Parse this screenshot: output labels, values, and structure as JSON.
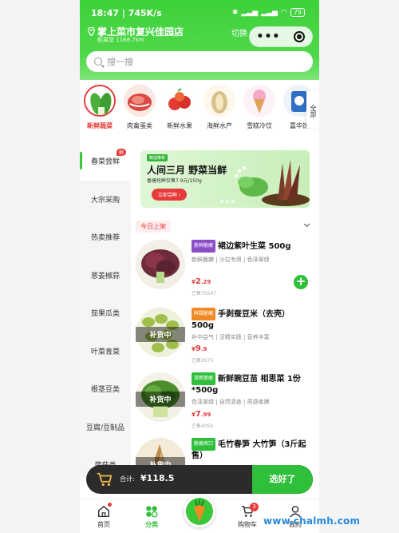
{
  "status": {
    "time": "18:47 | 745K/s",
    "battery": "79"
  },
  "header": {
    "location": "掌上菜市复兴佳园店",
    "distance": "距离您 1168.7km",
    "switch_label": "切换 ›"
  },
  "search": {
    "placeholder": "搜一搜"
  },
  "categories": [
    {
      "label": "新鲜蔬菜",
      "selected": true
    },
    {
      "label": "肉禽蛋类",
      "selected": false
    },
    {
      "label": "新鲜水果",
      "selected": false
    },
    {
      "label": "海鲜水产",
      "selected": false
    },
    {
      "label": "雪糕冷饮",
      "selected": false
    },
    {
      "label": "嘉华饼",
      "selected": false
    }
  ],
  "all_label": "全部",
  "sidebar": {
    "items": [
      "春菜尝鲜",
      "大宗采购",
      "热卖推荐",
      "葱姜椒蒜",
      "茄果瓜类",
      "叶菜青菜",
      "根茎豆类",
      "豆腐/豆制品",
      "菌菇类"
    ],
    "fresh_badge": "鲜"
  },
  "banner": {
    "tag": "精选推荐",
    "title": "人间三月 野菜当鲜",
    "subtitle": "香椿抢鲜仅售7.9元/250g",
    "button": "立即尝鲜 ›"
  },
  "list": {
    "section_label": "今日上架",
    "items": [
      {
        "badge": "新鲜脆嫩",
        "badge_color": "#8b4dc7",
        "name": "裙边紫叶生菜 500g",
        "desc": "新鲜脆嫩 | 沙拉专用 | 色泽翠绿",
        "price_int": "2",
        "price_dec": ".29",
        "sold": "已售75547",
        "stock": ""
      },
      {
        "badge": "鲜甜脆嫩",
        "badge_color": "#f08a24",
        "name": "手剥蚕豆米（去壳）500g",
        "desc": "补中益气 | 涩精实肠 | 营养丰富",
        "price_int": "9",
        "price_dec": ".9",
        "sold": "已售2675",
        "stock": "补货中"
      },
      {
        "badge": "清新脆嫩",
        "badge_color": "#2fbf3a",
        "name": "新鲜豌豆苗 相思菜 1份*500g",
        "desc": "色泽翠绿 | 自然清香 | 质感柔嫩",
        "price_int": "7",
        "price_dec": ".99",
        "sold": "已售4050",
        "stock": "补货中"
      },
      {
        "badge": "脆嫩爽口",
        "badge_color": "#2fbf3a",
        "name": "毛竹春笋 大竹笋（3斤起售）",
        "desc": "",
        "price_int": "",
        "price_dec": "",
        "sold": "",
        "stock": "补货中"
      }
    ]
  },
  "cart": {
    "total_label": "合计:",
    "total": "¥118.5",
    "go_label": "选好了"
  },
  "tabbar": {
    "home": "首页",
    "category": "分类",
    "cart": "购物车",
    "cart_count": "3",
    "mine": "我的"
  },
  "watermark": "www.chalmh.com",
  "colors": {
    "brand_green": "#3bc838",
    "accent_red": "#e73b3b"
  }
}
